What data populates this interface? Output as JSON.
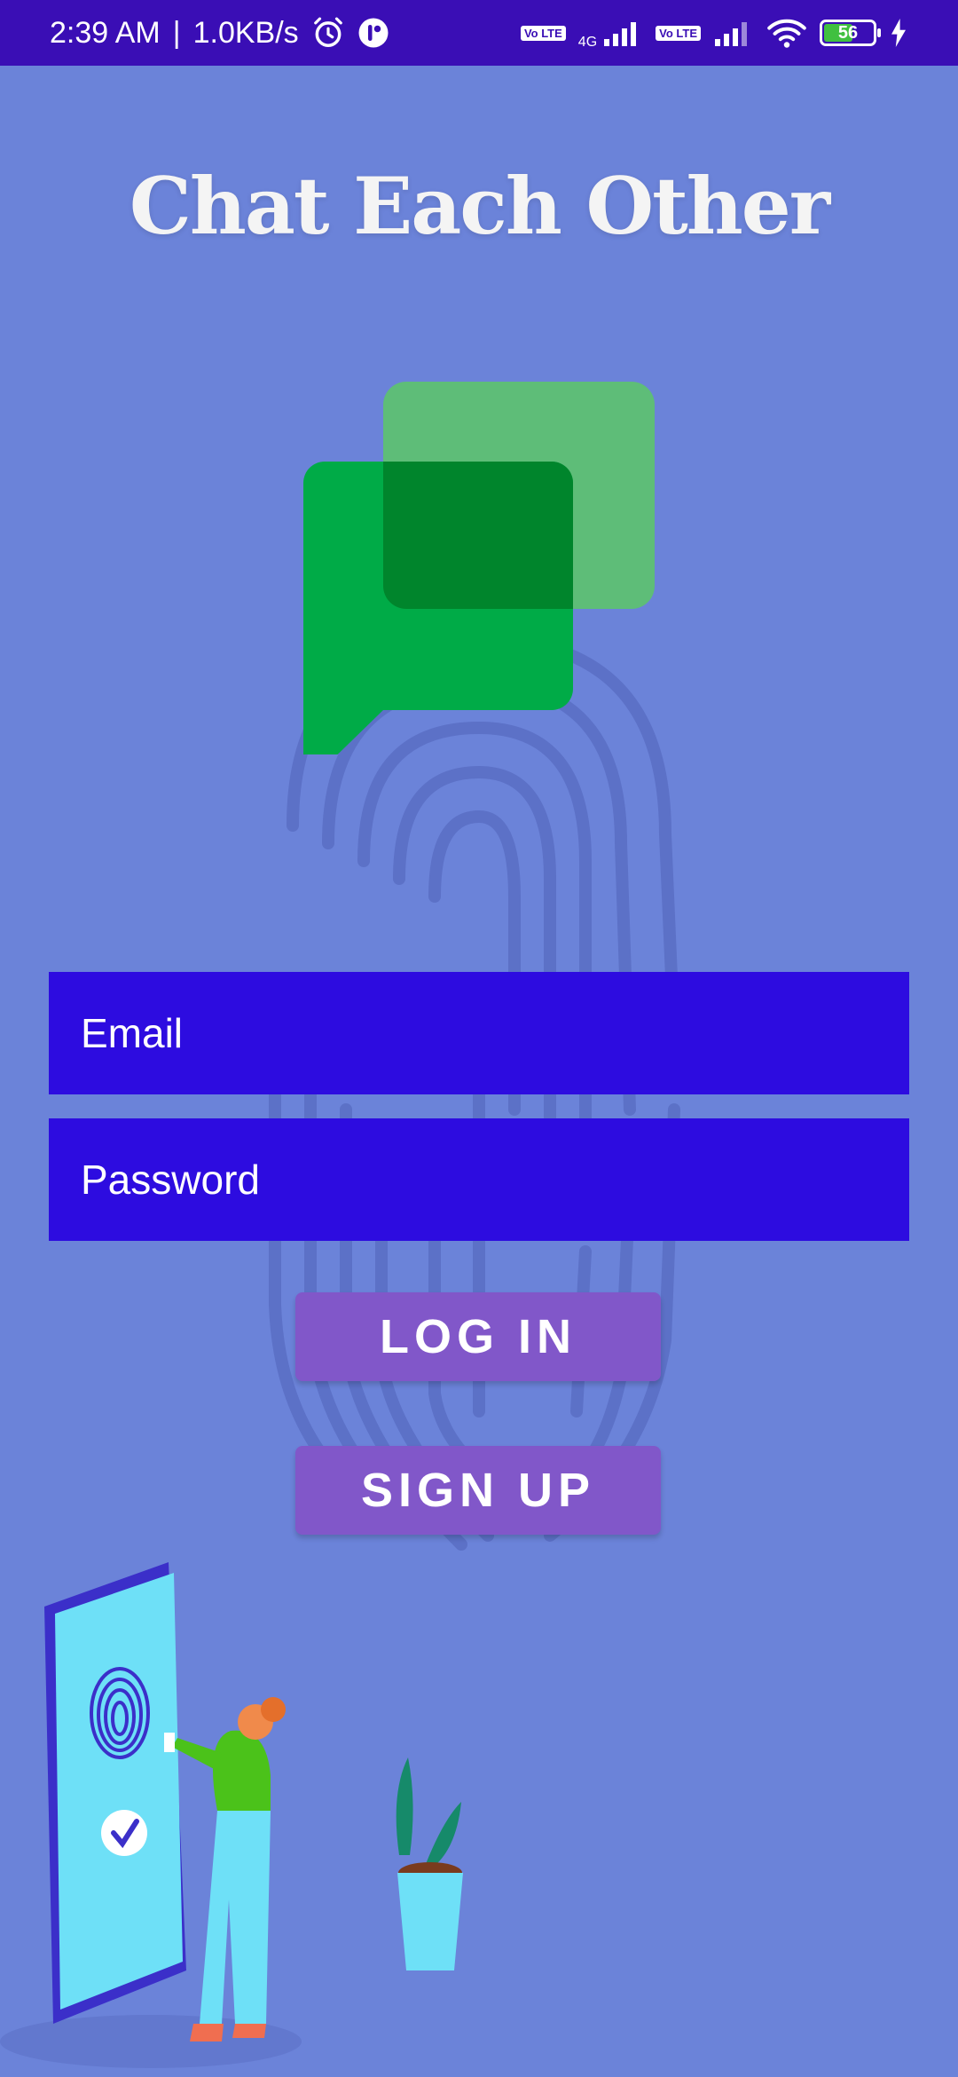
{
  "status_bar": {
    "time": "2:39 AM",
    "speed": "1.0KB/s",
    "network_tag": "4G",
    "volte_label": "Vo LTE",
    "battery_level": "56"
  },
  "app": {
    "title": "Chat Each Other"
  },
  "login_form": {
    "email_placeholder": "Email",
    "password_placeholder": "Password",
    "login_label": "LOG IN",
    "signup_label": "SIGN UP"
  },
  "colors": {
    "background": "#6b83d9",
    "status_bar": "#3a0eb5",
    "input_background": "#2d0ce0",
    "button": "#8157c9",
    "logo_green": "#00ab47",
    "logo_light_green": "#5ebd78"
  },
  "icons": [
    "alarm-icon",
    "app-notification-icon",
    "signal-icon",
    "wifi-icon",
    "battery-icon",
    "charging-icon",
    "chat-bubbles-logo-icon",
    "fingerprint-icon"
  ]
}
